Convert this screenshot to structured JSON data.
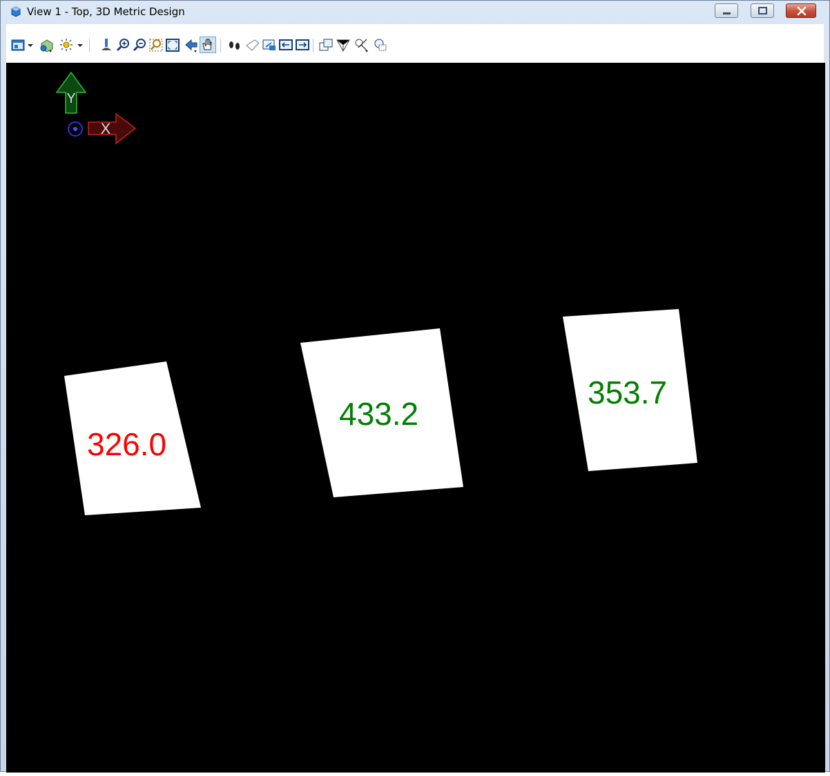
{
  "window": {
    "title": "View 1 - Top, 3D Metric Design"
  },
  "toolbar": {
    "icons": [
      "view-attributes-icon",
      "dropdown-arrow-icon",
      "view-display-mode-icon",
      "lighting-icon",
      "dropdown-arrow-icon",
      "update-view-icon",
      "zoom-in-icon",
      "zoom-out-icon",
      "window-area-icon",
      "fit-view-icon",
      "rotate-view-icon",
      "pan-view-icon",
      "walk-icon",
      "view-previous-icon",
      "view-next-icon",
      "copy-view-icon",
      "camera-icon",
      "clip-volume-icon",
      "clip-mask-icon",
      "change-view-perspective-icon"
    ]
  },
  "view_axes": {
    "y_label": "Y",
    "x_label": "X"
  },
  "labels": [
    {
      "text": "326.0",
      "color": "#ff0000"
    },
    {
      "text": "433.2",
      "color": "#008000"
    },
    {
      "text": "353.7",
      "color": "#008000"
    }
  ],
  "colors": {
    "background": "#000000",
    "label_fill": "#ffffff"
  }
}
